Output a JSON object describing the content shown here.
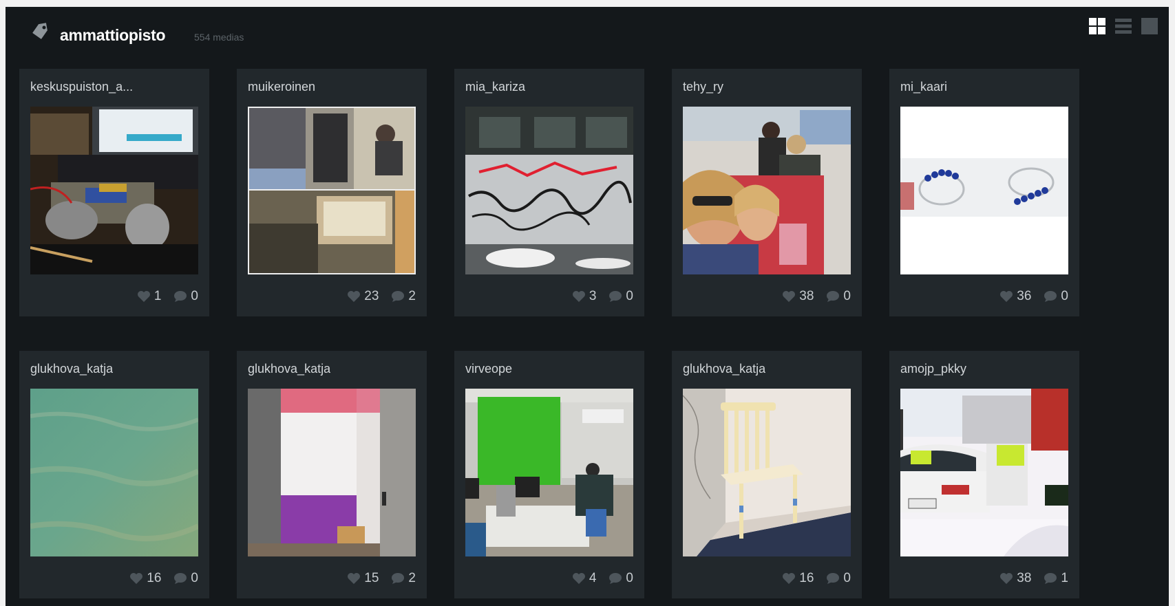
{
  "header": {
    "tag_name": "ammattiopisto",
    "media_count": "554 medias",
    "tag_icon": "tag-icon",
    "views": [
      "grid-view-icon",
      "list-view-icon",
      "single-view-icon"
    ]
  },
  "colors": {
    "background": "#14181b",
    "card": "#22282c",
    "text": "#d2d6d9",
    "muted": "#5c6368"
  },
  "cards": [
    {
      "user": "keskuspuiston_a...",
      "likes": "1",
      "comments": "0",
      "thumb": "robot-electronics"
    },
    {
      "user": "muikeroinen",
      "likes": "23",
      "comments": "2",
      "thumb": "collage"
    },
    {
      "user": "mia_kariza",
      "likes": "3",
      "comments": "0",
      "thumb": "graffiti-wall"
    },
    {
      "user": "tehy_ry",
      "likes": "38",
      "comments": "0",
      "thumb": "selfie"
    },
    {
      "user": "mi_kaari",
      "likes": "36",
      "comments": "0",
      "thumb": "bracelets"
    },
    {
      "user": "glukhova_katja",
      "likes": "16",
      "comments": "0",
      "thumb": "green-texture"
    },
    {
      "user": "glukhova_katja",
      "likes": "15",
      "comments": "2",
      "thumb": "painted-wall"
    },
    {
      "user": "virveope",
      "likes": "4",
      "comments": "0",
      "thumb": "green-screen-classroom"
    },
    {
      "user": "glukhova_katja",
      "likes": "16",
      "comments": "0",
      "thumb": "chair"
    },
    {
      "user": "amojp_pkky",
      "likes": "38",
      "comments": "1",
      "thumb": "car-snow"
    }
  ]
}
